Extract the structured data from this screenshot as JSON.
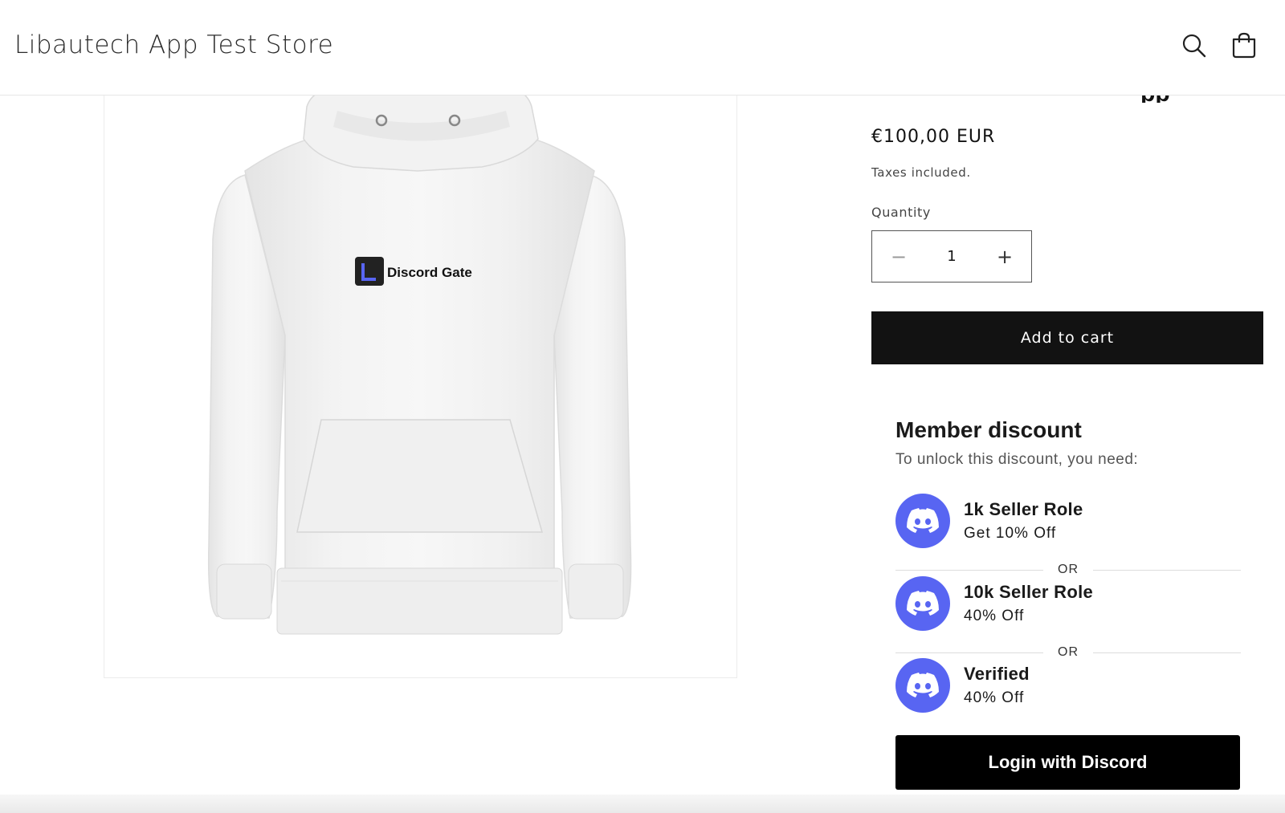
{
  "header": {
    "store_name": "Libautech App Test Store",
    "icons": [
      "search-icon",
      "cart-icon"
    ]
  },
  "product": {
    "print_logo_text": "Discord Gate",
    "title_partial": "pp",
    "price": "€100,00 EUR",
    "taxes_note": "Taxes included.",
    "quantity_label": "Quantity",
    "quantity_value": "1",
    "minus_symbol": "−",
    "plus_symbol": "+",
    "add_to_cart_label": "Add to cart"
  },
  "member_discount": {
    "title": "Member discount",
    "subtitle": "To unlock this discount, you need:",
    "or_label": "OR",
    "icon": "discord-icon",
    "accent_color": "#5865F2",
    "roles": [
      {
        "name": "1k Seller Role",
        "perk": "Get 10% Off"
      },
      {
        "name": "10k Seller Role",
        "perk": "40% Off"
      },
      {
        "name": "Verified",
        "perk": "40% Off"
      }
    ],
    "login_label": "Login with Discord"
  }
}
